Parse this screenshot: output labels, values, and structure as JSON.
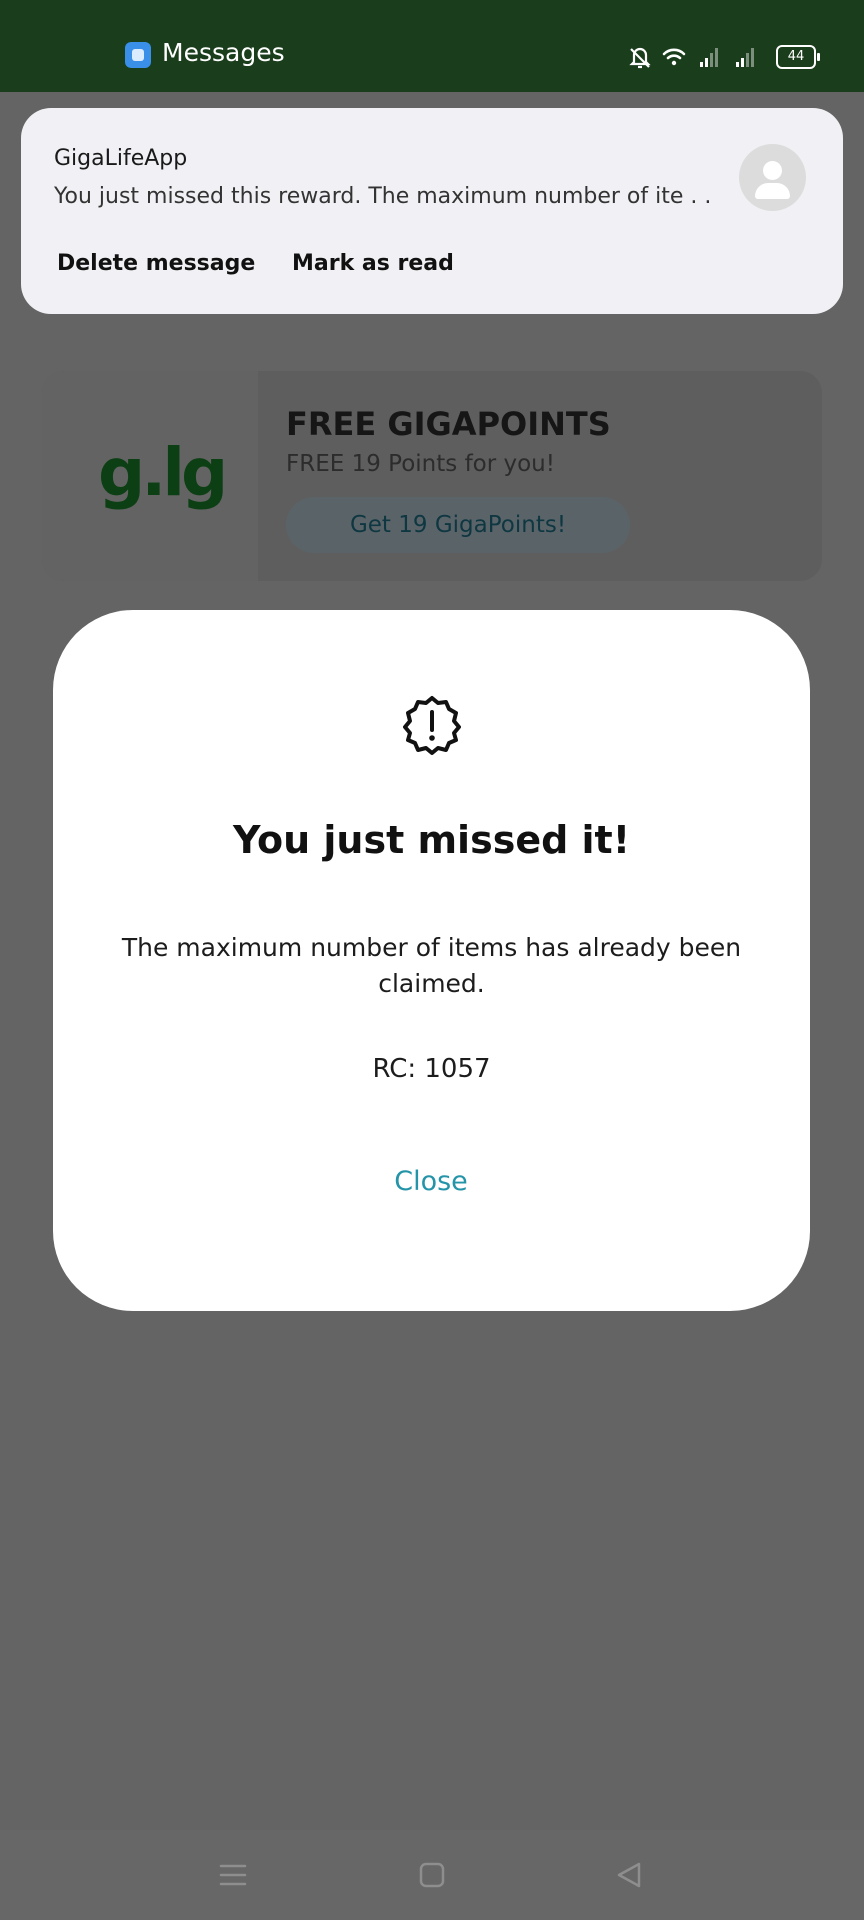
{
  "status_bar": {
    "app_name": "Messages",
    "battery_level": "44",
    "icons": [
      "messages-app-icon",
      "bell-off-icon",
      "wifi-icon",
      "signal-icon",
      "signal-icon",
      "battery-icon"
    ]
  },
  "notification": {
    "sender": "GigaLifeApp",
    "body": "You just missed this reward.  The maximum number of ite . .",
    "delete_label": "Delete message",
    "mark_read_label": "Mark as read",
    "avatar_icon": "person-icon"
  },
  "promo": {
    "logo_text": "g.lg",
    "title": "FREE GIGAPOINTS",
    "subtitle": "FREE 19 Points for you!",
    "button_label": "Get 19 GigaPoints!"
  },
  "dialog": {
    "icon": "alert-badge-icon",
    "title": "You just missed it!",
    "message": "The maximum number of items has already been claimed.",
    "code": "RC: 1057",
    "close_label": "Close"
  },
  "nav_bar": {
    "buttons": [
      "menu-icon",
      "home-icon",
      "back-icon"
    ]
  },
  "colors": {
    "status_bar_bg": "#1a3d1c",
    "overlay_bg": "#646464",
    "accent": "#2494a8",
    "logo_green": "#0d3f14"
  }
}
